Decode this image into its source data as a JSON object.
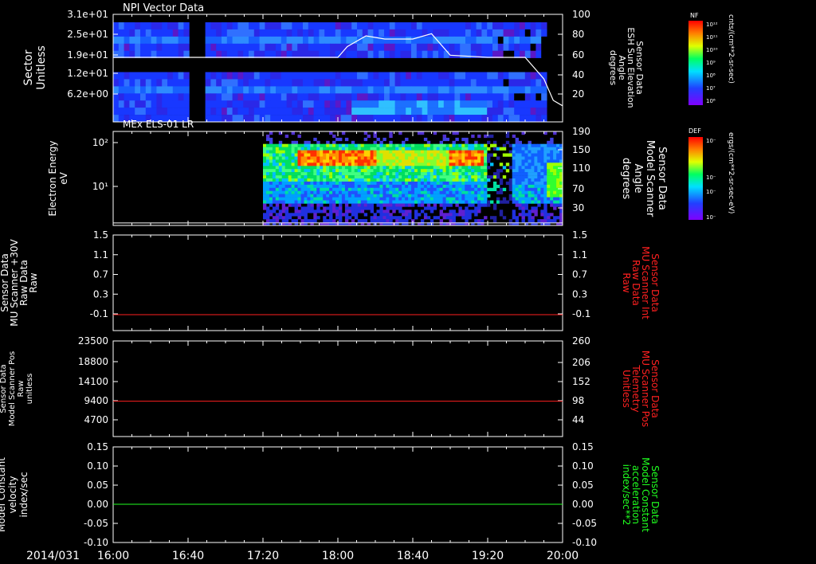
{
  "date_label": "2014/031",
  "time_ticks": [
    "16:00",
    "16:40",
    "17:20",
    "18:00",
    "18:40",
    "19:20",
    "20:00"
  ],
  "colors": {
    "red": "#ff2020",
    "green": "#20ff20",
    "white": "#ffffff"
  },
  "colorbars": [
    {
      "label": "NF",
      "unit": "cnts/(cm**2-sr-sec)",
      "ticks": [
        "10¹²",
        "10¹¹",
        "10¹⁰",
        "10⁹",
        "10⁸",
        "10⁷",
        "10⁶"
      ]
    },
    {
      "label": "DEF",
      "unit": "ergs/(cm**2-sr-sec-eV)",
      "ticks": [
        "10⁻",
        "10⁻",
        "10⁻",
        "10⁻"
      ]
    }
  ],
  "chart_data": [
    {
      "type": "heatmap",
      "title": "NPI Vector Data",
      "ylabel": [
        "Sector",
        "Unitless"
      ],
      "y_ticks": [
        "3.1e+01",
        "2.5e+01",
        "1.9e+01",
        "1.2e+01",
        "6.2e+00"
      ],
      "right_ylabel": [
        "Sensor Data",
        "ESH Sun Elevation",
        "Angle",
        "degrees"
      ],
      "right_ticks": [
        "100",
        "80",
        "60",
        "40",
        "20"
      ],
      "right_ylim": [
        0,
        100
      ],
      "data_gap": [
        "16:40",
        "16:48"
      ],
      "overlay_line": {
        "name": "ESH Sun Elevation",
        "x": [
          "16:00",
          "18:00",
          "18:05",
          "18:15",
          "18:25",
          "18:40",
          "18:50",
          "19:00",
          "19:20",
          "19:40",
          "19:50",
          "19:55",
          "20:00"
        ],
        "y": [
          60,
          60,
          70,
          80,
          77,
          77,
          82,
          62,
          60,
          60,
          40,
          20,
          15
        ]
      }
    },
    {
      "type": "heatmap",
      "title": "MEx ELS-01 LR",
      "ylabel": [
        "Electron Energy",
        "eV"
      ],
      "y_ticks": [
        "10²",
        "10¹"
      ],
      "right_ylabel": [
        "Sensor Data",
        "Model Scanner",
        "Angle",
        "degrees"
      ],
      "right_ticks": [
        "190",
        "150",
        "110",
        "70",
        "30"
      ],
      "right_ylim": [
        0,
        190
      ],
      "data_start": "17:20",
      "overlay_line": {
        "name": "Model Scanner Angle",
        "x": [
          "16:00",
          "20:00"
        ],
        "y": [
          5,
          5
        ]
      }
    },
    {
      "type": "line",
      "ylabel": [
        "Sensor Data",
        "MU Scanner +30V",
        "Raw Data",
        "Raw"
      ],
      "y_ticks": [
        "1.5",
        "1.1",
        "0.7",
        "0.3",
        "-0.1"
      ],
      "ylim": [
        -0.3,
        1.5
      ],
      "right_ylabel": [
        "Sensor Data",
        "MU Scanner Int",
        "Raw Data",
        "Raw"
      ],
      "right_ticks": [
        "1.5",
        "1.1",
        "0.7",
        "0.3",
        "-0.1"
      ],
      "right_color": "#ff2020",
      "series": [
        {
          "color": "#ff2020",
          "x": [
            "16:00",
            "20:00"
          ],
          "values": [
            0.0,
            0.0
          ]
        }
      ]
    },
    {
      "type": "line",
      "ylabel": [
        "Sensor Data",
        "Model Scanner Pos",
        "Raw",
        "unitless"
      ],
      "y_ticks": [
        "23500",
        "18800",
        "14100",
        "9400",
        "4700"
      ],
      "ylim": [
        0,
        23500
      ],
      "right_ylabel": [
        "Sensor Data",
        "MU Scanner Pos",
        "Telemetry",
        "Unitless"
      ],
      "right_ticks": [
        "260",
        "206",
        "152",
        "98",
        "44"
      ],
      "right_color": "#ff2020",
      "series": [
        {
          "color": "#ff2020",
          "x": [
            "16:00",
            "20:00"
          ],
          "values": [
            8700,
            8700
          ]
        }
      ]
    },
    {
      "type": "line",
      "ylabel": [
        "Sensor Data",
        "Model Constant",
        "velocity",
        "index/sec"
      ],
      "y_ticks": [
        "0.15",
        "0.10",
        "0.05",
        "0.00",
        "-0.05",
        "-0.10"
      ],
      "ylim": [
        -0.1,
        0.15
      ],
      "right_ylabel": [
        "Sensor Data",
        "Model Constant",
        "acceleration",
        "index/sec**2"
      ],
      "right_ticks": [
        "0.15",
        "0.10",
        "0.05",
        "0.00",
        "-0.05",
        "-0.10"
      ],
      "right_color": "#20ff20",
      "series": [
        {
          "color": "#20ff20",
          "x": [
            "16:00",
            "20:00"
          ],
          "values": [
            0.0,
            0.0
          ]
        }
      ]
    }
  ]
}
